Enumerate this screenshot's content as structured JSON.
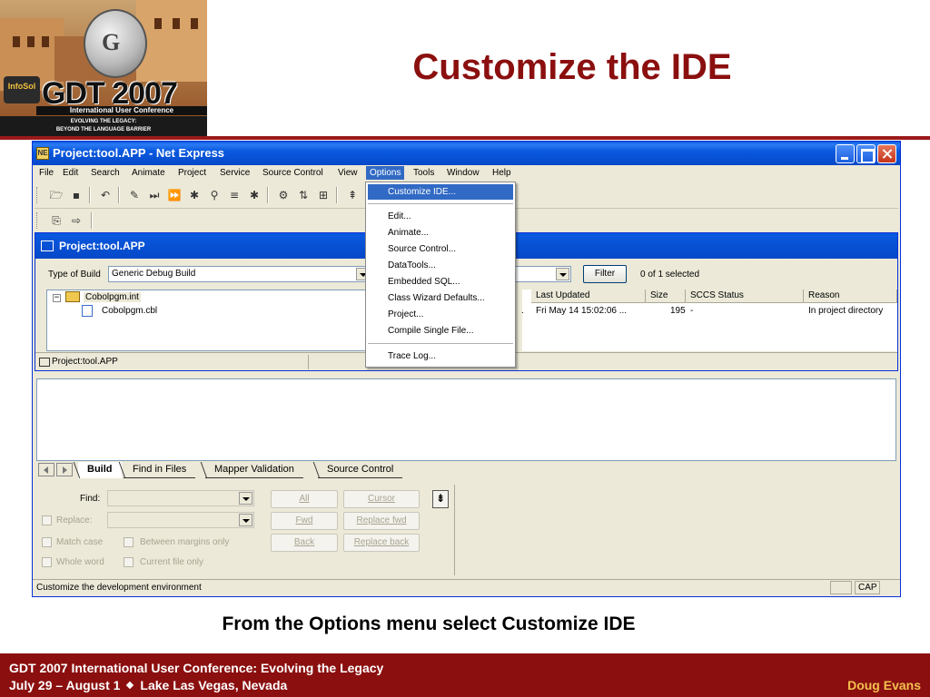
{
  "slide": {
    "title": "Customize the IDE",
    "caption": "From the Options menu select Customize IDE",
    "footer_line1": "GDT 2007 International User Conference: Evolving the Legacy",
    "footer_line2_a": "July 29 – August 1",
    "footer_line2_b": "Lake Las Vegas, Nevada",
    "footer_author": "Doug Evans",
    "logo": {
      "title": "GDT 2007",
      "line1": "International User Conference",
      "line2": "EVOLVING THE LEGACY:",
      "line3": "BEYOND THE LANGUAGE BARRIER",
      "badge": "InfoSol"
    },
    "colors": {
      "accent": "#8b0f0f",
      "footer_author": "#f2c14e",
      "xp_blue": "#0a5ae0",
      "highlight": "#316ac5"
    }
  },
  "window": {
    "title": "Project:tool.APP - Net Express",
    "menubar": [
      "File",
      "Edit",
      "Search",
      "Animate",
      "Project",
      "Service",
      "Source Control",
      "View",
      "Options",
      "Tools",
      "Window",
      "Help"
    ],
    "active_menu": "Options",
    "toolbar_icons": [
      "open-folder-icon",
      "save-icon",
      "undo-icon",
      "wand-icon",
      "step-icon",
      "run-icon",
      "zoom-icon",
      "list-icon",
      "breakpoint-icon",
      "watch-icon",
      "compile-icon",
      "build-icon"
    ],
    "subwindow": {
      "title": "Project:tool.APP",
      "type_of_build_label": "Type of Build",
      "type_of_build_value": "Generic Debug Build",
      "filter_label": "Filter",
      "selected_count": "0 of 1 selected",
      "tree": {
        "root": "Cobolpgm.int",
        "child": "Cobolpgm.cbl"
      },
      "columns": [
        "Last Updated",
        "Size",
        "SCCS Status",
        "Reason"
      ],
      "row": {
        "prefix": ".",
        "last_updated": "Fri May 14 15:02:06 ...",
        "size": "195",
        "sccs_status": "-",
        "reason": "In project directory"
      },
      "status": "Project:tool.APP"
    },
    "output_tabs": [
      "Build",
      "Find in Files",
      "Mapper Validation",
      "Source Control"
    ],
    "selected_tab": "Build",
    "find_panel": {
      "find_label": "Find:",
      "replace_label": "Replace:",
      "match_case": "Match case",
      "whole_word": "Whole word",
      "between_margins": "Between margins only",
      "current_file": "Current file only",
      "btn_all": "All",
      "btn_fwd": "Fwd",
      "btn_back": "Back",
      "btn_cursor": "Cursor",
      "btn_replace_fwd": "Replace fwd",
      "btn_replace_back": "Replace back"
    },
    "statusbar": {
      "text": "Customize the development environment",
      "cap": "CAP"
    }
  },
  "options_menu": {
    "items": [
      "Customize IDE...",
      "Edit...",
      "Animate...",
      "Source Control...",
      "DataTools...",
      "Embedded SQL...",
      "Class Wizard Defaults...",
      "Project...",
      "Compile Single File...",
      "Trace Log..."
    ],
    "highlighted": "Customize IDE..."
  }
}
